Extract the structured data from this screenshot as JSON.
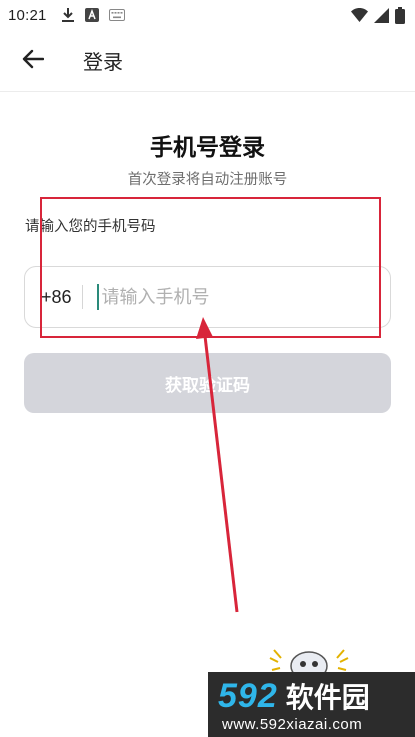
{
  "status_bar": {
    "time": "10:21",
    "icons_left": [
      "download-icon",
      "app-a-icon",
      "keyboard-icon"
    ],
    "icons_right": [
      "wifi-icon",
      "cellular-signal-icon",
      "battery-icon"
    ]
  },
  "app_bar": {
    "back_icon": "arrow-left-icon",
    "title": "登录"
  },
  "login": {
    "title": "手机号登录",
    "subtitle": "首次登录将自动注册账号",
    "phone_label": "请输入您的手机号码",
    "country_code": "+86",
    "phone_placeholder": "请输入手机号",
    "phone_value": "",
    "get_code_label": "获取验证码"
  },
  "annotation": {
    "color": "#d8253a"
  },
  "watermark": {
    "number": "592",
    "name": "软件园",
    "url": "www.592xiazai.com",
    "number_color": "#2fb6ea",
    "background": "#2c2c2c"
  },
  "colors": {
    "button_disabled": "#d4d5db",
    "caret": "#2a8a7a",
    "input_border": "#d9d9d9"
  }
}
